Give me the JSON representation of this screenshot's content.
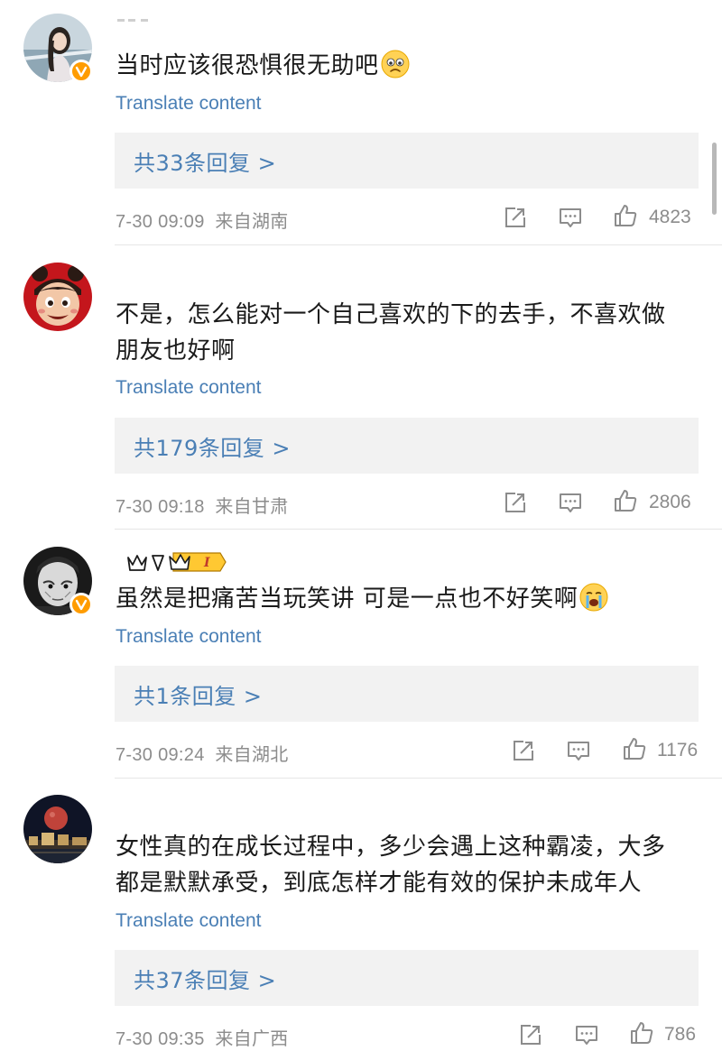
{
  "comments": [
    {
      "text": "当时应该很恐惧很无助吧",
      "translate_label": "Translate content",
      "replies_label": "共33条回复 >",
      "timestamp": "7-30 09:09",
      "location": "来自湖南",
      "likes": "4823"
    },
    {
      "text_line1": "不是，怎么能对一个自己喜欢的下的去手，不喜欢做",
      "text_line2": "朋友也好啊",
      "translate_label": "Translate content",
      "replies_label": "共179条回复 >",
      "timestamp": "7-30 09:18",
      "location": "来自甘肃",
      "likes": "2806"
    },
    {
      "text": "虽然是把痛苦当玩笑讲 可是一点也不好笑啊",
      "translate_label": "Translate content",
      "replies_label": "共1条回复 >",
      "timestamp": "7-30 09:24",
      "location": "来自湖北",
      "likes": "1176"
    },
    {
      "text_line1": "女性真的在成长过程中，多少会遇上这种霸凌，大多",
      "text_line2": "都是默默承受，到底怎样才能有效的保护未成年人",
      "translate_label": "Translate content",
      "replies_label": "共37条回复 >",
      "timestamp": "7-30 09:35",
      "location": "来自广西",
      "likes": "786"
    }
  ],
  "icons": {
    "share": "share-icon",
    "comment": "comment-icon",
    "like": "thumbs-up-icon",
    "verified": "verified-badge-icon"
  },
  "colors": {
    "link": "#4a7fb5",
    "meta": "#8c8c8c",
    "reply_bg": "#f2f2f2",
    "verified_badge": "#ff9c00"
  }
}
